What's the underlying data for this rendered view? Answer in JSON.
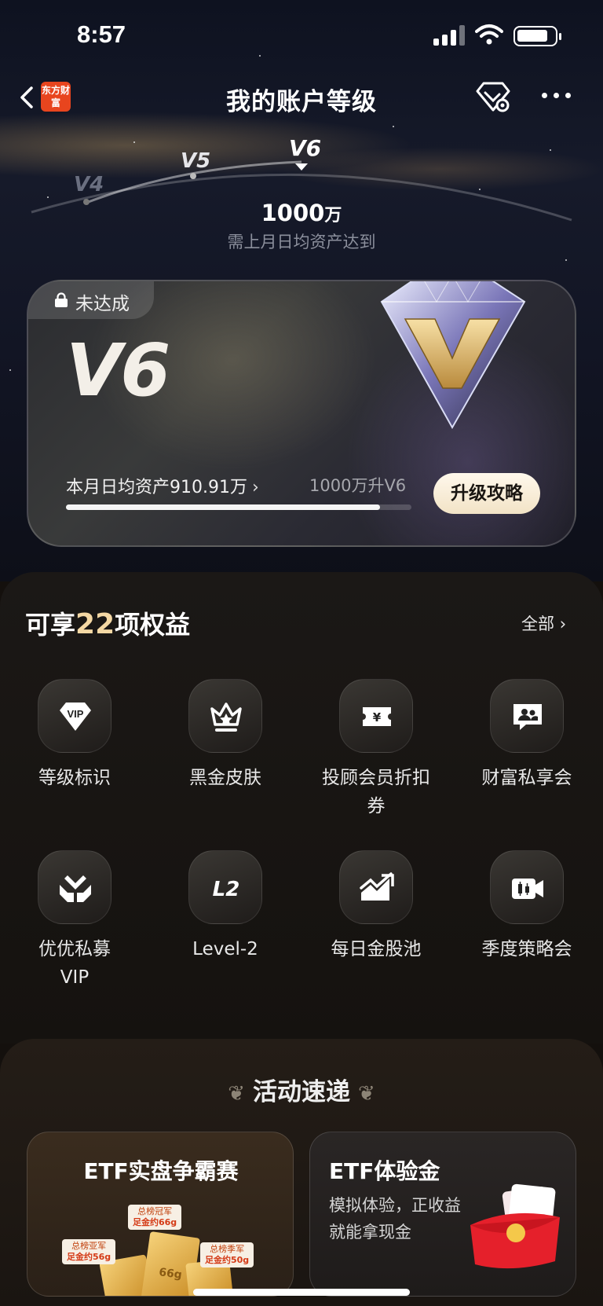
{
  "status_bar": {
    "time": "8:57"
  },
  "nav": {
    "brand_logo_text": "东方财富",
    "title": "我的账户等级"
  },
  "levels": {
    "prev2": "V4",
    "prev1": "V5",
    "current": "V6"
  },
  "target": {
    "value": "1000",
    "unit": "万",
    "caption": "需上月日均资产达到"
  },
  "level_card": {
    "status": "未达成",
    "level": "V6",
    "avg_asset_text": "本月日均资产910.91万",
    "upgrade_target_text": "1000万升V6",
    "progress_fraction": 0.91,
    "upgrade_button": "升级攻略"
  },
  "benefits": {
    "title_prefix": "可享",
    "count": "22",
    "title_suffix": "项权益",
    "all_link": "全部",
    "items": [
      {
        "label": "等级标识",
        "icon": "vip-diamond-icon"
      },
      {
        "label": "黑金皮肤",
        "icon": "crown-icon"
      },
      {
        "label": "投顾会员折扣券",
        "icon": "coupon-yen-icon"
      },
      {
        "label": "财富私享会",
        "icon": "people-chat-icon"
      },
      {
        "label": "优优私募VIP",
        "icon": "hands-heart-icon"
      },
      {
        "label": "Level-2",
        "icon": "l2-icon"
      },
      {
        "label": "每日金股池",
        "icon": "trend-chart-icon"
      },
      {
        "label": "季度策略会",
        "icon": "video-camera-icon"
      }
    ]
  },
  "activities": {
    "title": "活动速递",
    "cards": [
      {
        "title": "ETF实盘争霸赛",
        "tags": [
          {
            "line1": "总榜冠军",
            "line2": "足金约66g"
          },
          {
            "line1": "总榜亚军",
            "line2": "足金约56g"
          },
          {
            "line1": "总榜季军",
            "line2": "足金约50g"
          }
        ],
        "bar_label": "66g"
      },
      {
        "title": "ETF体验金",
        "subtitle": "模拟体验，正收益就能拿现金"
      }
    ]
  },
  "colors": {
    "accent_gold": "#f4d8a4",
    "brand_orange": "#e8451e"
  }
}
